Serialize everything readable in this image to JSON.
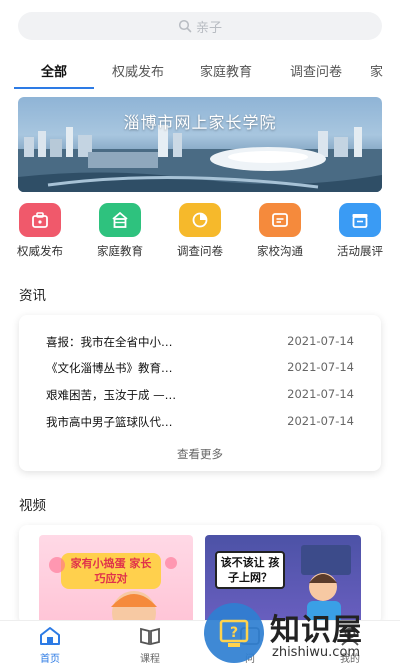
{
  "search": {
    "placeholder": "亲子"
  },
  "tabs": [
    {
      "label": "全部",
      "active": true
    },
    {
      "label": "权威发布"
    },
    {
      "label": "家庭教育"
    },
    {
      "label": "调查问卷"
    },
    {
      "label": "家"
    }
  ],
  "banner": {
    "title": "淄博市网上家长学院"
  },
  "quick_actions": [
    {
      "label": "权威发布",
      "icon": "briefcase-icon",
      "color": "#f0596b"
    },
    {
      "label": "家庭教育",
      "icon": "house-icon",
      "color": "#2ec27e"
    },
    {
      "label": "调查问卷",
      "icon": "pie-chart-icon",
      "color": "#f6b92b"
    },
    {
      "label": "家校沟通",
      "icon": "chat-icon",
      "color": "#f58a3c"
    },
    {
      "label": "活动展评",
      "icon": "gift-icon",
      "color": "#3a9bf4"
    }
  ],
  "news": {
    "section_title": "资讯",
    "items": [
      {
        "title": "喜报：我市在全省中小…",
        "date": "2021-07-14"
      },
      {
        "title": "《文化淄博丛书》教育…",
        "date": "2021-07-14"
      },
      {
        "title": "艰难困苦，玉汝于成 —…",
        "date": "2021-07-14"
      },
      {
        "title": "我市高中男子篮球队代…",
        "date": "2021-07-14"
      }
    ],
    "more_label": "查看更多"
  },
  "videos": {
    "section_title": "视频",
    "items": [
      {
        "caption": "家有小捣蛋 家长巧应对"
      },
      {
        "caption": "该不该让 孩子上网？"
      }
    ]
  },
  "bottom_nav": [
    {
      "label": "首页",
      "icon": "home-icon",
      "active": true
    },
    {
      "label": "课程",
      "icon": "book-icon"
    },
    {
      "label": "问",
      "icon": "question-icon"
    },
    {
      "label": "我的",
      "icon": "user-icon"
    }
  ],
  "watermark": {
    "text": "知识屋",
    "url": "zhishiwu.com"
  },
  "colors": {
    "accent": "#2d7be5"
  }
}
